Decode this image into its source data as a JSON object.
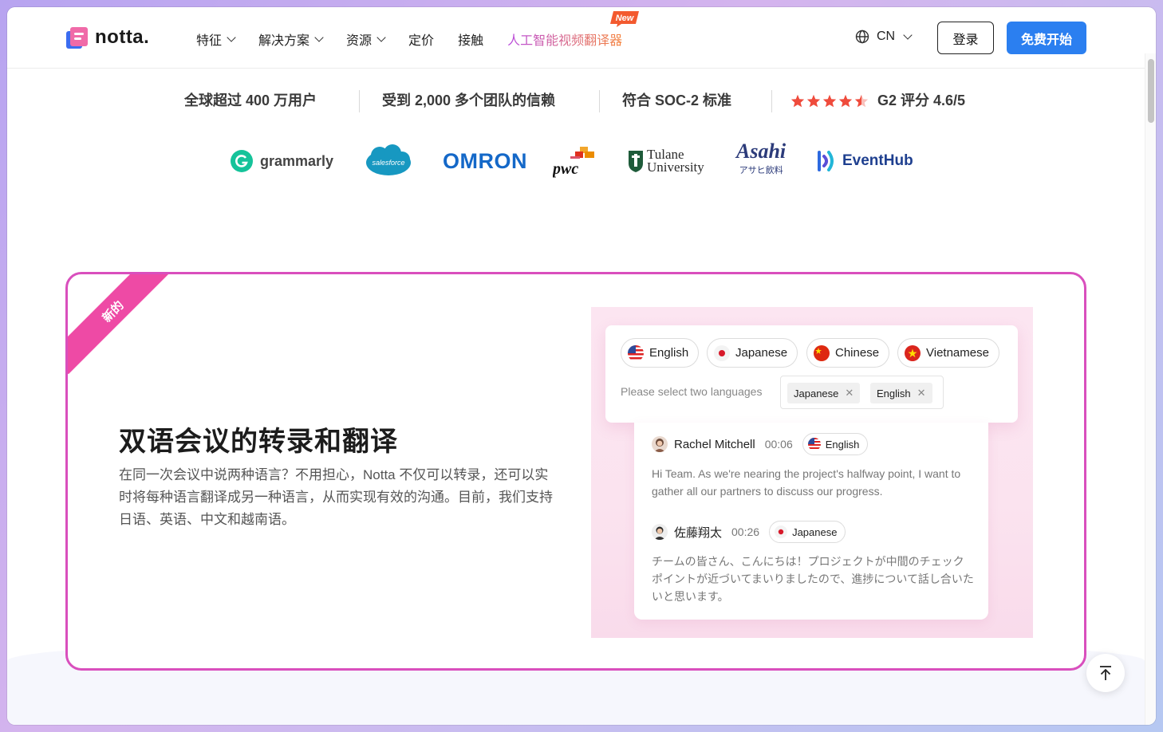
{
  "header": {
    "logo_text": "notta.",
    "nav": [
      {
        "label": "特征",
        "has_dropdown": true
      },
      {
        "label": "解决方案",
        "has_dropdown": true
      },
      {
        "label": "资源",
        "has_dropdown": true
      },
      {
        "label": "定价",
        "has_dropdown": false
      },
      {
        "label": "接触",
        "has_dropdown": false
      }
    ],
    "nav_ai_label": "人工智能视频翻译器",
    "new_badge": "New",
    "language": "CN",
    "login_label": "登录",
    "start_label": "免费开始"
  },
  "stats": {
    "users": "全球超过 400 万用户",
    "teams": "受到 2,000 多个团队的信赖",
    "soc": "符合 SOC-2 标准",
    "g2": "G2 评分 4.6/5",
    "rating": 4.6
  },
  "brands": {
    "grammarly": "grammarly",
    "salesforce": "salesforce",
    "omron": "OMRON",
    "pwc": "pwc",
    "tulane_1": "Tulane",
    "tulane_2": "University",
    "asahi_1": "Asahi",
    "asahi_2": "アサヒ飲料",
    "eventhub": "EventHub"
  },
  "feature": {
    "ribbon": "新的",
    "title": "双语会议的转录和翻译",
    "description": "在同一次会议中说两种语言？不用担心，Notta 不仅可以转录，还可以实时将每种语言翻译成另一种语言，从而实现有效的沟通。目前，我们支持日语、英语、中文和越南语。",
    "languages": [
      "English",
      "Japanese",
      "Chinese",
      "Vietnamese"
    ],
    "select_label": "Please select two languages",
    "selected_tags": [
      "Japanese",
      "English"
    ],
    "transcript": [
      {
        "speaker": "Rachel Mitchell",
        "time": "00:06",
        "language": "English",
        "text": "Hi Team. As we're nearing the project's halfway point, I want to gather all our partners to discuss our progress."
      },
      {
        "speaker": "佐藤翔太",
        "time": "00:26",
        "language": "Japanese",
        "text": "チームの皆さん、こんにちは！プロジェクトが中間のチェックポイントが近づいてまいりましたので、進捗について話し合いたいと思います。"
      }
    ]
  },
  "colors": {
    "accent_blue": "#2b7ff0",
    "card_border": "#d94fbd",
    "ribbon": "#ee4aa5",
    "star": "#ef4b3c"
  }
}
